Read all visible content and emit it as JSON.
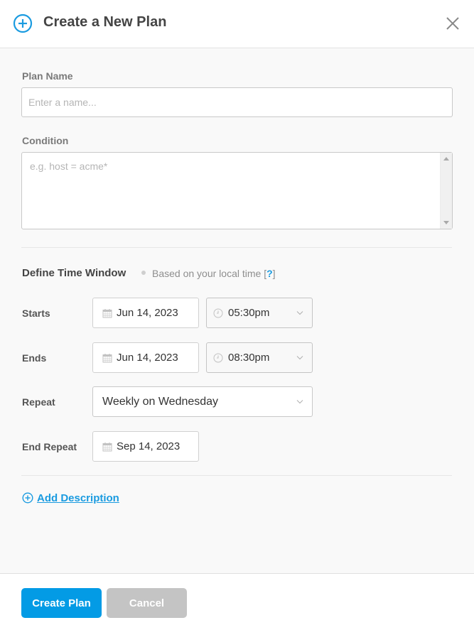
{
  "header": {
    "title": "Create a New Plan",
    "icon": "plus-circle-icon",
    "close_icon": "close-icon",
    "accent_color": "#1a9be0"
  },
  "form": {
    "plan_name": {
      "label": "Plan Name",
      "value": "",
      "placeholder": "Enter a name..."
    },
    "condition": {
      "label": "Condition",
      "value": "",
      "placeholder": "e.g. host = acme*"
    }
  },
  "time_window": {
    "title": "Define Time Window",
    "note": "Based on your local time [",
    "help": "?",
    "note_end": "]",
    "starts": {
      "label": "Starts",
      "date": "Jun 14, 2023",
      "time": "05:30pm"
    },
    "ends": {
      "label": "Ends",
      "date": "Jun 14, 2023",
      "time": "08:30pm"
    },
    "repeat": {
      "label": "Repeat",
      "value": "Weekly on Wednesday"
    },
    "end_repeat": {
      "label": "End Repeat",
      "date": "Sep 14, 2023"
    }
  },
  "add_description": {
    "label": "Add Description"
  },
  "footer": {
    "create_label": "Create Plan",
    "cancel_label": "Cancel",
    "primary_color": "#039be5",
    "secondary_color": "#c4c4c4"
  }
}
